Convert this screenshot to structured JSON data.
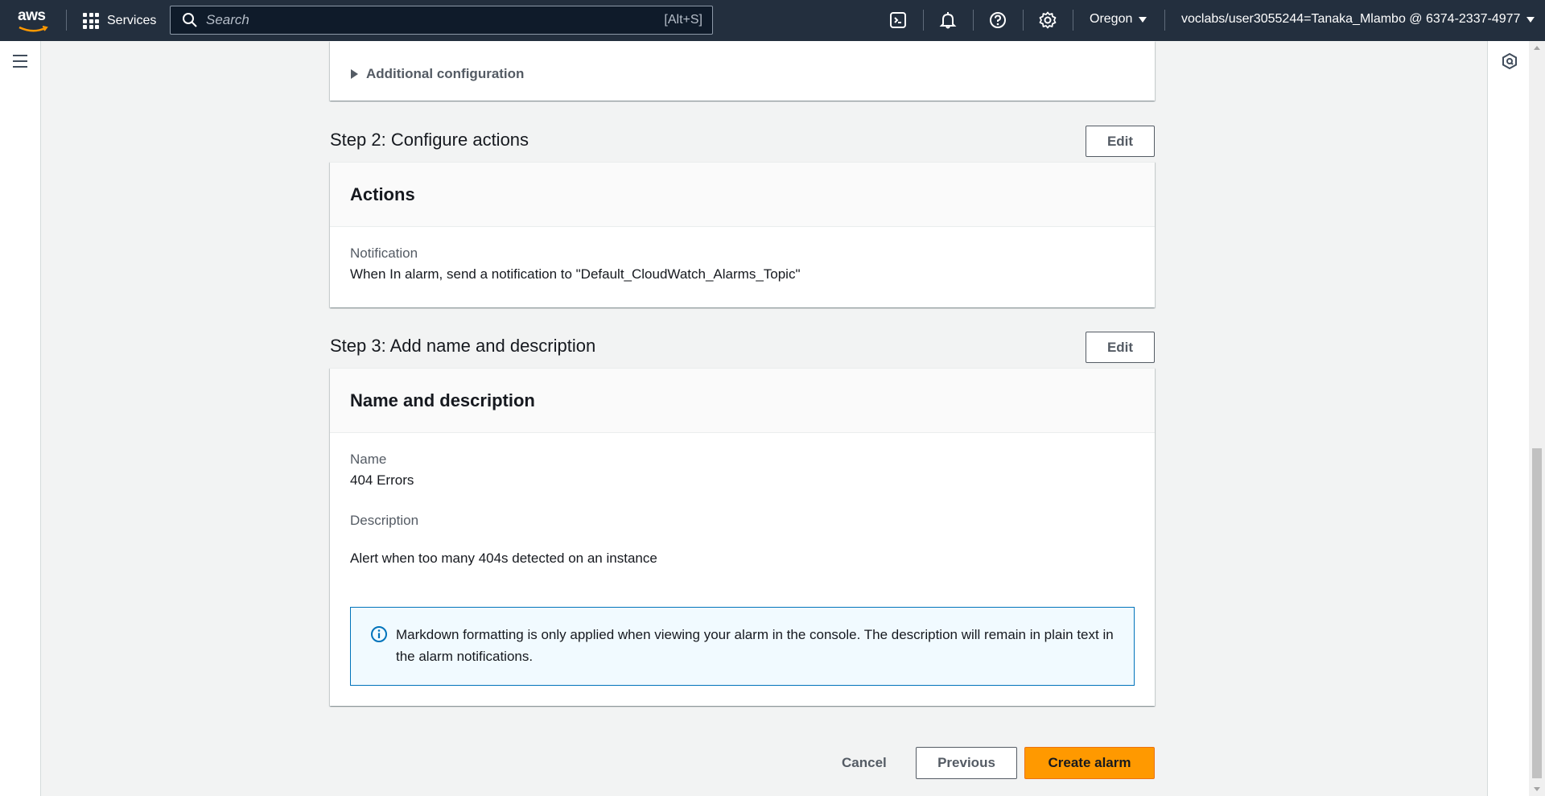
{
  "topnav": {
    "logo_text": "aws",
    "services_label": "Services",
    "search_placeholder": "Search",
    "search_shortcut": "[Alt+S]",
    "region": "Oregon",
    "account": "voclabs/user3055244=Tanaka_Mlambo @ 6374-2337-4977",
    "icons": [
      "cloudshell-icon",
      "notifications-bell-icon",
      "help-icon",
      "settings-gear-icon"
    ]
  },
  "step1": {
    "expander_label": "Additional configuration"
  },
  "step2": {
    "title": "Step 2: Configure actions",
    "edit_label": "Edit",
    "panel_title": "Actions",
    "notification_label": "Notification",
    "notification_value": "When In alarm, send a notification to \"Default_CloudWatch_Alarms_Topic\""
  },
  "step3": {
    "title": "Step 3: Add name and description",
    "edit_label": "Edit",
    "panel_title": "Name and description",
    "name_label": "Name",
    "name_value": "404 Errors",
    "description_label": "Description",
    "description_value": "Alert when too many 404s detected on an instance",
    "info_text": "Markdown formatting is only applied when viewing your alarm in the console. The description will remain in plain text in the alarm notifications."
  },
  "footer": {
    "cancel_label": "Cancel",
    "previous_label": "Previous",
    "create_label": "Create alarm"
  },
  "colors": {
    "nav_bg": "#232f3e",
    "primary_button": "#ff9900",
    "info_border": "#0073bb",
    "info_bg": "#f1faff"
  }
}
